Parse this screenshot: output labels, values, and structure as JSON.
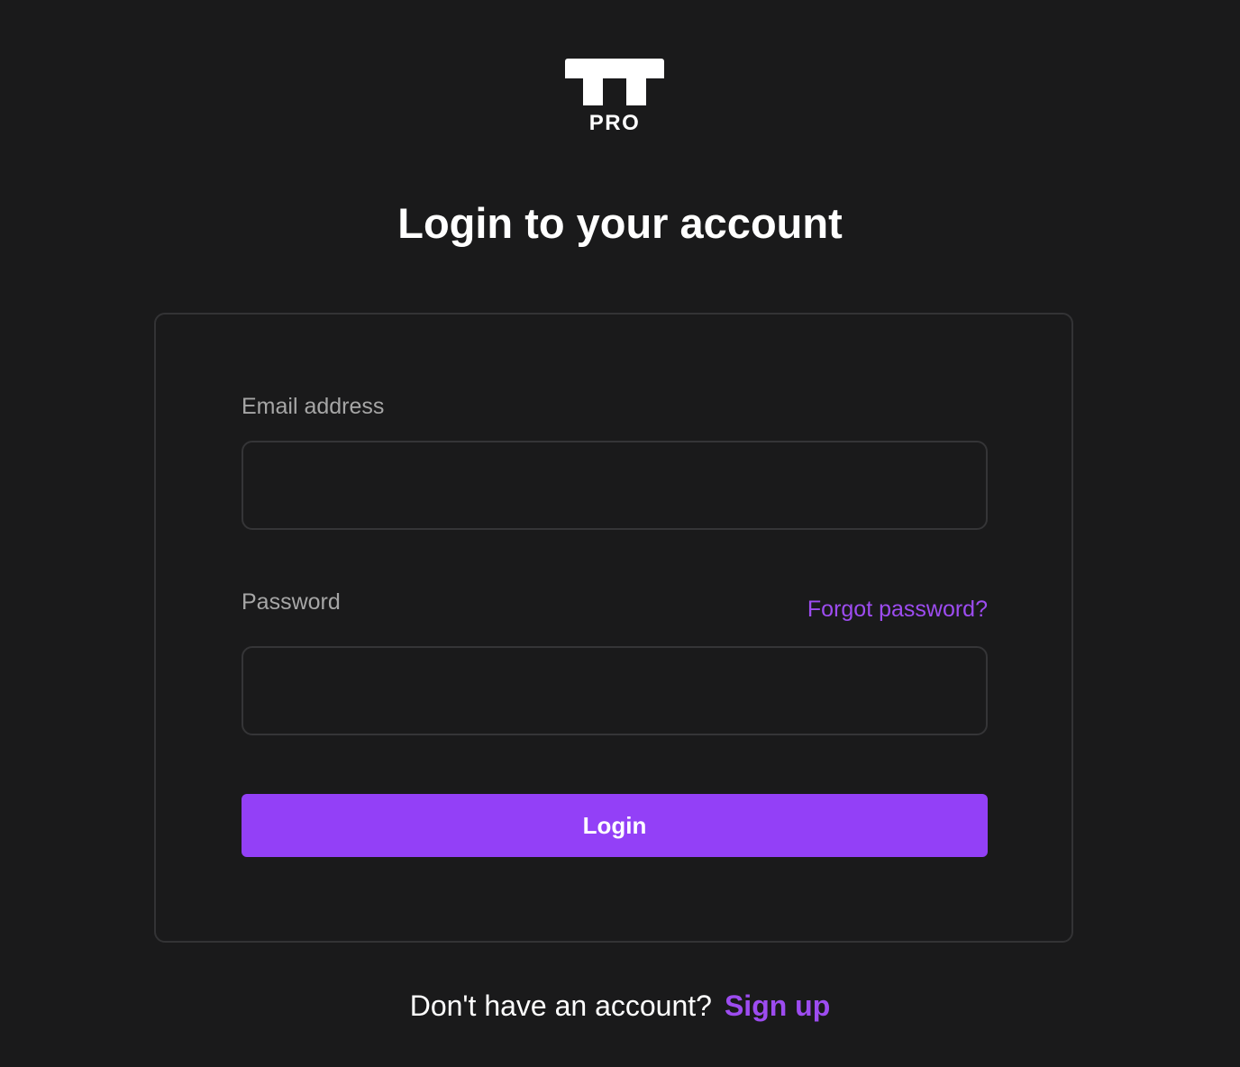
{
  "logo": {
    "text": "PRO",
    "icon": "tt-logo-icon"
  },
  "heading": "Login to your account",
  "form": {
    "email_label": "Email address",
    "email_value": "",
    "password_label": "Password",
    "password_value": "",
    "forgot_password": "Forgot password?",
    "login_button": "Login"
  },
  "footer": {
    "prompt": "Don't have an account?",
    "signup_link": "Sign up"
  },
  "colors": {
    "background": "#1a1a1b",
    "accent": "#9340f7",
    "link": "#9d4cf0",
    "label": "#a6a6a6",
    "border": "#333335"
  }
}
